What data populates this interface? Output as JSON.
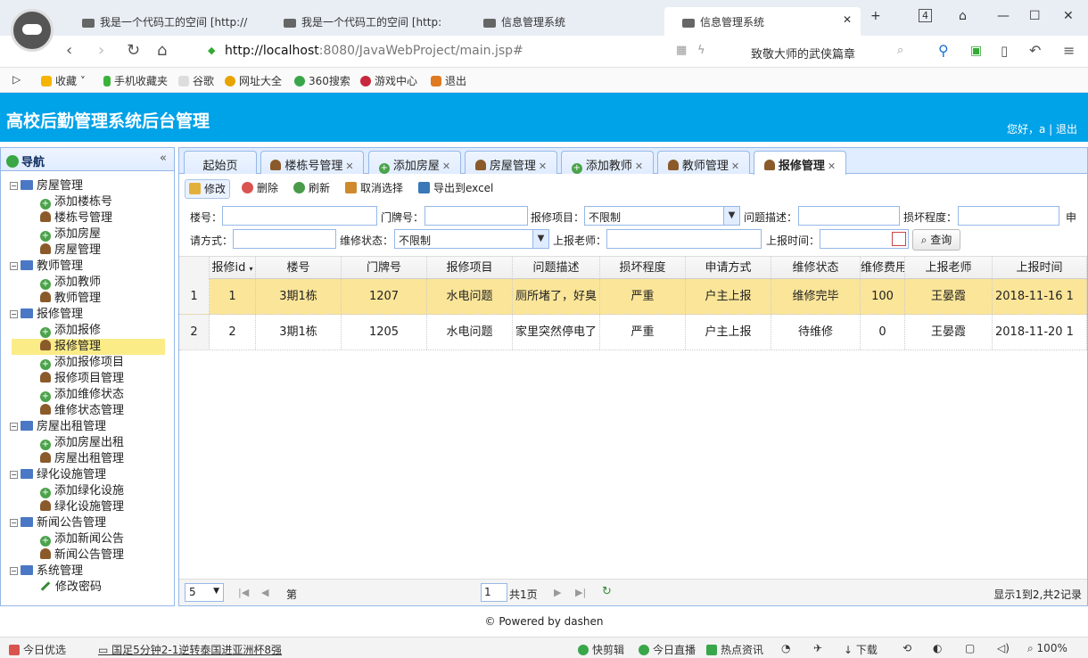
{
  "browser": {
    "tabs": [
      {
        "title": "我是一个代码工的空间 [http://"
      },
      {
        "title": "我是一个代码工的空间 [http:"
      },
      {
        "title": "信息管理系统"
      },
      {
        "title": "信息管理系统"
      }
    ],
    "tab_count": "4",
    "url_host": "http://localhost",
    "url_rest": ":8080/JavaWebProject/main.jsp#",
    "search_text": "致敬大师的武侠篇章",
    "bookmarks": [
      "收藏",
      "手机收藏夹",
      "谷歌",
      "网址大全",
      "360搜索",
      "游戏中心",
      "退出"
    ]
  },
  "app": {
    "title": "高校后勤管理系统后台管理",
    "user_text": "您好，a | 退出"
  },
  "nav": {
    "title": "导航",
    "collapse": "«",
    "groups": [
      {
        "label": "房屋管理",
        "items": [
          "添加楼栋号",
          "楼栋号管理",
          "添加房屋",
          "房屋管理"
        ]
      },
      {
        "label": "教师管理",
        "items": [
          "添加教师",
          "教师管理"
        ]
      },
      {
        "label": "报修管理",
        "items": [
          "添加报修",
          "报修管理",
          "添加报修项目",
          "报修项目管理",
          "添加维修状态",
          "维修状态管理"
        ]
      },
      {
        "label": "房屋出租管理",
        "items": [
          "添加房屋出租",
          "房屋出租管理"
        ]
      },
      {
        "label": "绿化设施管理",
        "items": [
          "添加绿化设施",
          "绿化设施管理"
        ]
      },
      {
        "label": "新闻公告管理",
        "items": [
          "添加新闻公告",
          "新闻公告管理"
        ]
      },
      {
        "label": "系统管理",
        "items": [
          "修改密码"
        ]
      }
    ]
  },
  "tabs": [
    "起始页",
    "楼栋号管理",
    "添加房屋",
    "房屋管理",
    "添加教师",
    "教师管理",
    "报修管理"
  ],
  "toolbar": {
    "edit": "修改",
    "delete": "删除",
    "refresh": "刷新",
    "cancel_select": "取消选择",
    "export": "导出到excel"
  },
  "search": {
    "building_label": "楼号：",
    "door_label": "门牌号：",
    "item_label": "报修项目：",
    "item_value": "不限制",
    "desc_label": "问题描述：",
    "damage_label": "损坏程度：",
    "apply_label_a": "申",
    "apply_label_b": "请方式：",
    "status_label": "维修状态：",
    "status_value": "不限制",
    "teacher_label": "上报老师：",
    "time_label": "上报时间：",
    "query_btn": "查询"
  },
  "grid": {
    "columns": [
      "报修id",
      "楼号",
      "门牌号",
      "报修项目",
      "问题描述",
      "损坏程度",
      "申请方式",
      "维修状态",
      "维修费用",
      "上报老师",
      "上报时间"
    ],
    "rows": [
      {
        "num": "1",
        "cells": [
          "1",
          "3期1栋",
          "1207",
          "水电问题",
          "厕所堵了，好臭",
          "严重",
          "户主上报",
          "维修完毕",
          "100",
          "王晏霞",
          "2018-11-16 1"
        ]
      },
      {
        "num": "2",
        "cells": [
          "2",
          "3期1栋",
          "1205",
          "水电问题",
          "家里突然停电了",
          "严重",
          "户主上报",
          "待维修",
          "0",
          "王晏霞",
          "2018-11-20 1"
        ]
      }
    ]
  },
  "pager": {
    "page_size": "5",
    "page_prefix": "第",
    "page_value": "1",
    "page_suffix": "共1页",
    "info": "显示1到2,共2记录"
  },
  "footer": "© Powered by dashen",
  "statusbar": {
    "left_app": "今日优选",
    "news": "国足5分钟2-1逆转泰国进亚洲杯8强",
    "items": [
      "快剪辑",
      "今日直播",
      "热点资讯",
      "下载"
    ],
    "zoom": "100%"
  },
  "colors": {
    "header": "#00a2e8",
    "selected_row": "#fbe599",
    "panel_border": "#95b8e7"
  }
}
